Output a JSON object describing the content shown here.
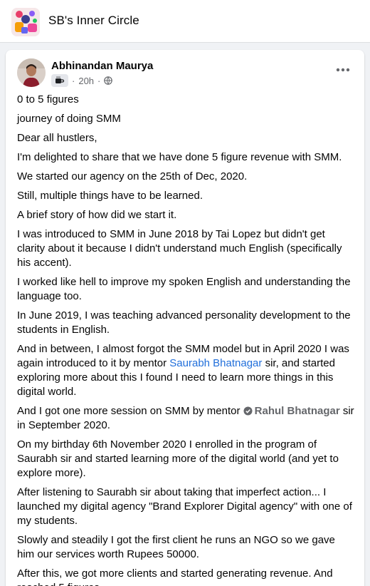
{
  "group": {
    "name": "SB's Inner Circle"
  },
  "post": {
    "author": "Abhinandan Maurya",
    "time": "20h",
    "paragraphs": [
      {
        "segments": [
          {
            "t": "0 to 5 figures"
          }
        ]
      },
      {
        "segments": [
          {
            "t": "journey of doing SMM"
          }
        ]
      },
      {
        "segments": [
          {
            "t": "Dear all hustlers,"
          }
        ]
      },
      {
        "segments": [
          {
            "t": "I'm delighted to share that we have done 5 figure revenue with SMM."
          }
        ]
      },
      {
        "segments": [
          {
            "t": "We started our agency on the 25th of Dec, 2020."
          }
        ]
      },
      {
        "segments": [
          {
            "t": "Still, multiple things have to be learned."
          }
        ]
      },
      {
        "segments": [
          {
            "t": "A brief story of how did we start it."
          }
        ]
      },
      {
        "segments": [
          {
            "t": "I was introduced to SMM in June 2018 by Tai Lopez but didn't get clarity about it because I didn't understand much English (specifically his accent)."
          }
        ]
      },
      {
        "segments": [
          {
            "t": "I worked like hell to improve my spoken English and understanding the language too."
          }
        ]
      },
      {
        "segments": [
          {
            "t": "In June 2019, I was teaching advanced personality development to the students in English."
          }
        ]
      },
      {
        "segments": [
          {
            "t": "And in between, I almost forgot the SMM model but in April 2020 I was again introduced to it by mentor "
          },
          {
            "t": "Saurabh Bhatnagar",
            "kind": "link"
          },
          {
            "t": " sir, and started exploring more about this I found I need to learn more things in this digital world."
          }
        ]
      },
      {
        "segments": [
          {
            "t": "And I got one more session on SMM by mentor "
          },
          {
            "t": "Rahul Bhatnagar",
            "kind": "mention"
          },
          {
            "t": " sir in September 2020."
          }
        ]
      },
      {
        "segments": [
          {
            "t": "On my birthday 6th November 2020 I enrolled in the program of Saurabh sir and started learning more of the digital world (and yet to explore more)."
          }
        ]
      },
      {
        "segments": [
          {
            "t": "After listening to Saurabh sir about taking that imperfect action... I launched my digital agency \"Brand Explorer Digital agency\" with one of my students."
          }
        ]
      },
      {
        "segments": [
          {
            "t": "Slowly and steadily I got the first client he runs an NGO so we gave him our services worth Rupees 50000."
          }
        ]
      },
      {
        "segments": [
          {
            "t": "After this, we got more clients and started generating revenue. And reached 5 figures..."
          }
        ]
      }
    ]
  },
  "icons": {
    "more": "more-options-icon",
    "privacy": "globe-icon",
    "badge": "coffee-badge-icon",
    "verified": "verified-icon"
  },
  "colors": {
    "link": "#216fdb",
    "muted": "#65676b",
    "background": "#f0f2f5"
  }
}
